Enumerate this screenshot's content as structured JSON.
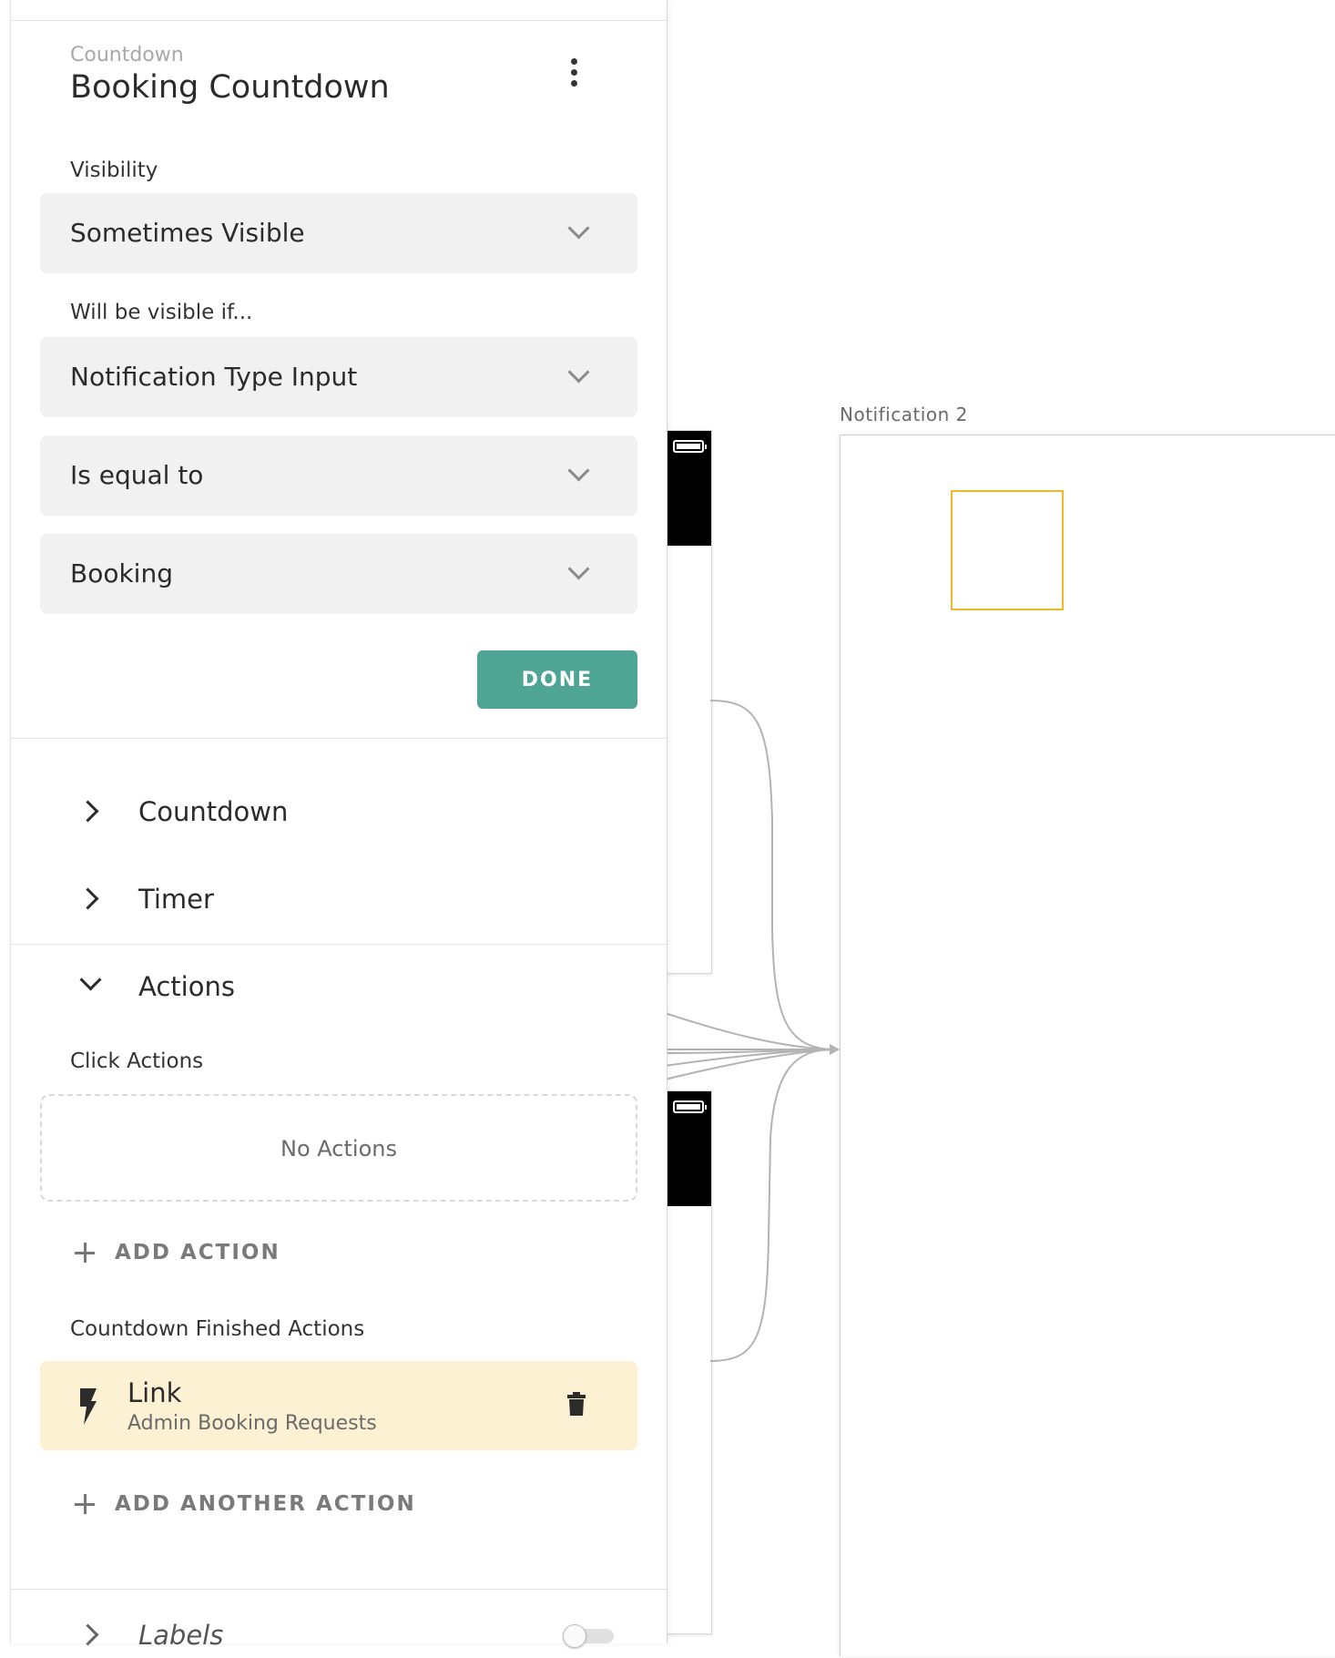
{
  "component": {
    "type_label": "Countdown",
    "name": "Booking Countdown"
  },
  "visibility": {
    "label": "Visibility",
    "value": "Sometimes Visible",
    "condition_label": "Will be visible if...",
    "field": "Notification Type Input",
    "operator": "Is equal to",
    "compare_value": "Booking",
    "done_label": "DONE"
  },
  "sections": {
    "countdown": "Countdown",
    "timer": "Timer",
    "actions": "Actions",
    "labels": "Labels"
  },
  "actions": {
    "click_label": "Click Actions",
    "empty_text": "No Actions",
    "add_label": "ADD ACTION",
    "finished_label": "Countdown Finished Actions",
    "finished_items": [
      {
        "title": "Link",
        "subtitle": "Admin Booking Requests"
      }
    ],
    "add_another_label": "ADD ANOTHER ACTION"
  },
  "canvas": {
    "screen_label": "Notification 2"
  },
  "colors": {
    "accent": "#4fa594",
    "action_card_bg": "#fcf1d3",
    "selection": "#f2b62a"
  }
}
